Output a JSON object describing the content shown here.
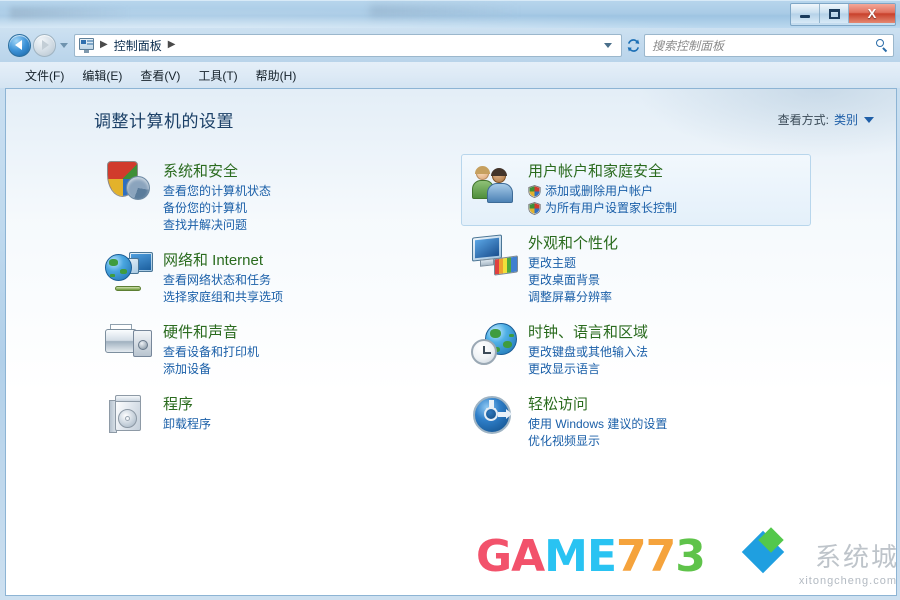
{
  "window": {
    "title": "",
    "caption_buttons": [
      {
        "name": "minimize",
        "glyph": ""
      },
      {
        "name": "maximize",
        "glyph": ""
      },
      {
        "name": "close",
        "glyph": "X"
      }
    ]
  },
  "addressbar": {
    "back_tooltip": "后退",
    "forward_tooltip": "前进",
    "icon": "control-panel-icon",
    "breadcrumb": [
      {
        "label": "控制面板"
      }
    ],
    "separator": "▶",
    "refresh_glyph": "↻"
  },
  "search": {
    "placeholder": "搜索控制面板",
    "value": "",
    "icon": "search-icon"
  },
  "menubar": {
    "items": [
      {
        "label": "文件(F)"
      },
      {
        "label": "编辑(E)"
      },
      {
        "label": "查看(V)"
      },
      {
        "label": "工具(T)"
      },
      {
        "label": "帮助(H)"
      }
    ]
  },
  "page": {
    "title": "调整计算机的设置",
    "view_by_label": "查看方式:",
    "view_by_value": "类别"
  },
  "categories": {
    "left": [
      {
        "icon": "security-shield-icon",
        "title": "系统和安全",
        "highlighted": false,
        "links": [
          {
            "label": "查看您的计算机状态",
            "shield": false
          },
          {
            "label": "备份您的计算机",
            "shield": false
          },
          {
            "label": "查找并解决问题",
            "shield": false
          }
        ]
      },
      {
        "icon": "network-globe-icon",
        "title": "网络和 Internet",
        "highlighted": false,
        "links": [
          {
            "label": "查看网络状态和任务",
            "shield": false
          },
          {
            "label": "选择家庭组和共享选项",
            "shield": false
          }
        ]
      },
      {
        "icon": "printer-speaker-icon",
        "title": "硬件和声音",
        "highlighted": false,
        "links": [
          {
            "label": "查看设备和打印机",
            "shield": false
          },
          {
            "label": "添加设备",
            "shield": false
          }
        ]
      },
      {
        "icon": "software-box-icon",
        "title": "程序",
        "highlighted": false,
        "links": [
          {
            "label": "卸载程序",
            "shield": false
          }
        ]
      }
    ],
    "right": [
      {
        "icon": "users-icon",
        "title": "用户帐户和家庭安全",
        "highlighted": true,
        "links": [
          {
            "label": "添加或删除用户帐户",
            "shield": true
          },
          {
            "label": "为所有用户设置家长控制",
            "shield": true
          }
        ]
      },
      {
        "icon": "appearance-icon",
        "title": "外观和个性化",
        "highlighted": false,
        "links": [
          {
            "label": "更改主题",
            "shield": false
          },
          {
            "label": "更改桌面背景",
            "shield": false
          },
          {
            "label": "调整屏幕分辨率",
            "shield": false
          }
        ]
      },
      {
        "icon": "clock-globe-icon",
        "title": "时钟、语言和区域",
        "highlighted": false,
        "links": [
          {
            "label": "更改键盘或其他输入法",
            "shield": false
          },
          {
            "label": "更改显示语言",
            "shield": false
          }
        ]
      },
      {
        "icon": "ease-of-access-icon",
        "title": "轻松访问",
        "highlighted": false,
        "links": [
          {
            "label": "使用 Windows 建议的设置",
            "shield": false
          },
          {
            "label": "优化视频显示",
            "shield": false
          }
        ]
      }
    ]
  },
  "watermark": {
    "part1": "GA",
    "part2": "ME",
    "part3": "77",
    "part4": "3",
    "overlay_cn": "系统城",
    "overlay_url": "xitongcheng.com"
  },
  "colors": {
    "category_title": "#2a6b1e",
    "link": "#1a5fa8",
    "page_title": "#1a3f66",
    "window_border": "#8db4d4",
    "close_button": "#c8412c",
    "highlight_bg": "#e4f0fa"
  }
}
